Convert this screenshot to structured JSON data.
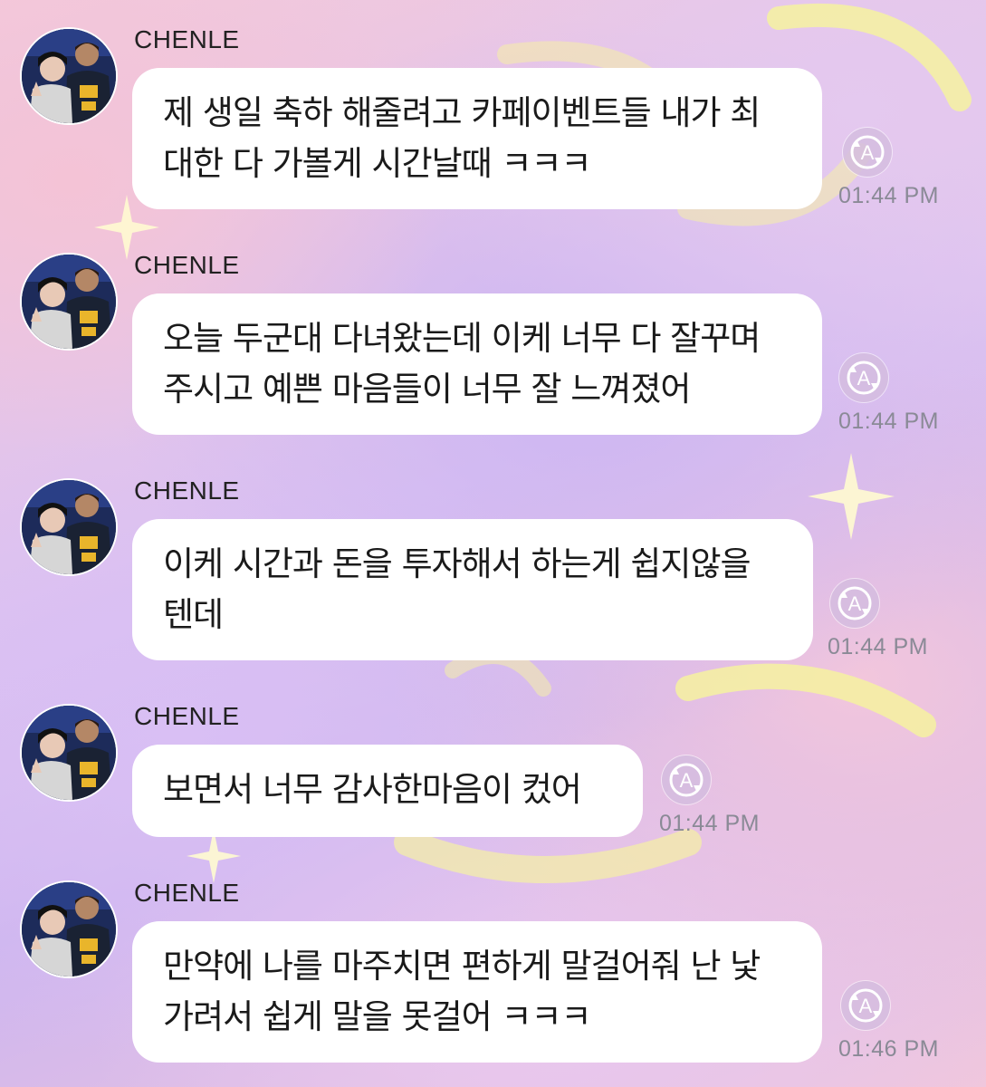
{
  "messages": [
    {
      "sender": "CHENLE",
      "lines": [
        "제 생일 축하 해줄려고 카페이벤트들 내가 최",
        "대한 다 가볼게 시간날때 ㅋㅋㅋ"
      ],
      "time": "01:44 PM"
    },
    {
      "sender": "CHENLE",
      "lines": [
        "오늘 두군대 다녀왔는데 이케 너무 다 잘꾸며",
        "주시고 예쁜 마음들이 너무 잘 느껴졌어"
      ],
      "time": "01:44 PM"
    },
    {
      "sender": "CHENLE",
      "lines": [
        "이케 시간과 돈을 투자해서 하는게 쉽지않을",
        "텐데"
      ],
      "time": "01:44 PM"
    },
    {
      "sender": "CHENLE",
      "lines": [
        "보면서 너무 감사한마음이 컸어"
      ],
      "time": "01:44 PM"
    },
    {
      "sender": "CHENLE",
      "lines": [
        "만약에 나를 마주치면 편하게 말걸어줘 난 낯",
        "가려서 쉽게 말을 못걸어 ㅋㅋㅋ"
      ],
      "time": "01:46 PM"
    }
  ],
  "icons": {
    "avatar": "profile-photo",
    "translate": "auto-translate-icon"
  },
  "colors": {
    "bubble": "#ffffff",
    "timestamp": "#8a8a96",
    "badge_ring": "#ffffff"
  }
}
